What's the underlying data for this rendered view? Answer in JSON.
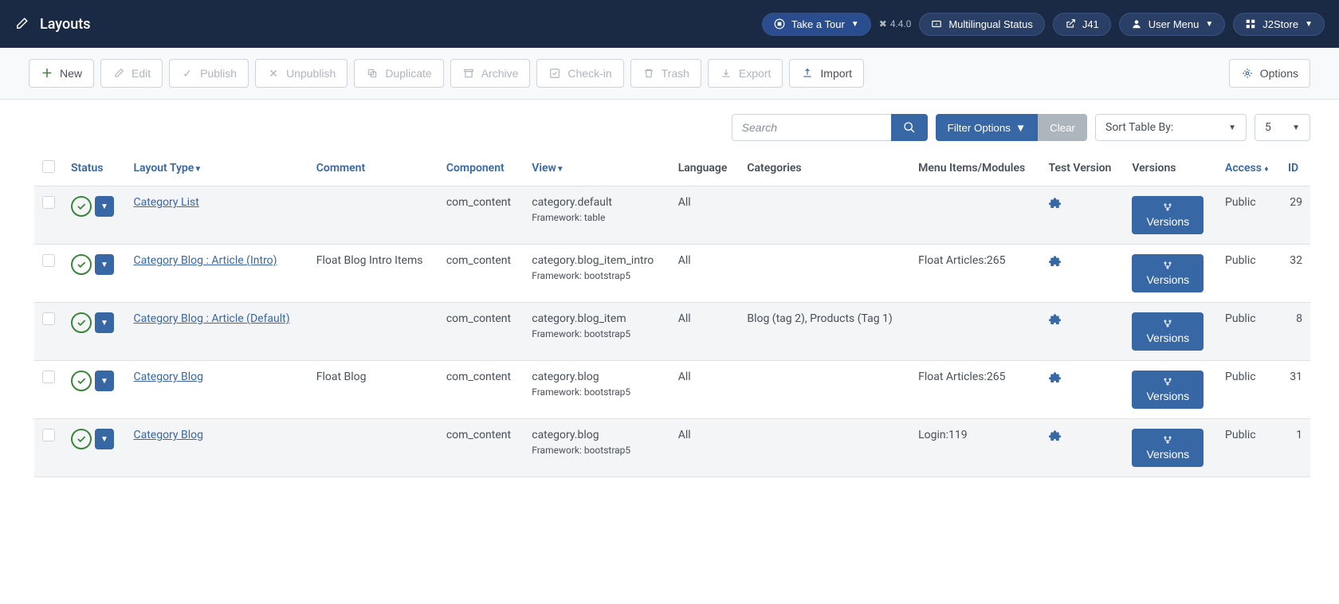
{
  "header": {
    "title": "Layouts",
    "take_tour": "Take a Tour",
    "version": "4.4.0",
    "multilingual": "Multilingual Status",
    "j41": "J41",
    "user_menu": "User Menu",
    "j2store": "J2Store"
  },
  "toolbar": {
    "new": "New",
    "edit": "Edit",
    "publish": "Publish",
    "unpublish": "Unpublish",
    "duplicate": "Duplicate",
    "archive": "Archive",
    "checkin": "Check-in",
    "trash": "Trash",
    "export": "Export",
    "import": "Import",
    "options": "Options"
  },
  "filters": {
    "search_placeholder": "Search",
    "filter_options": "Filter Options",
    "clear": "Clear",
    "sort_by": "Sort Table By:",
    "limit": "5"
  },
  "columns": {
    "status": "Status",
    "layout_type": "Layout Type",
    "comment": "Comment",
    "component": "Component",
    "view": "View",
    "language": "Language",
    "categories": "Categories",
    "menu_items": "Menu Items/Modules",
    "test_version": "Test Version",
    "versions": "Versions",
    "access": "Access",
    "id": "ID"
  },
  "framework_label": "Framework:",
  "versions_btn": "Versions",
  "rows": [
    {
      "layout_type": "Category List",
      "comment": "",
      "component": "com_content",
      "view": "category.default",
      "framework": "table",
      "language": "All",
      "categories": "",
      "menu_items": "",
      "access": "Public",
      "id": "29"
    },
    {
      "layout_type": "Category Blog : Article (Intro)",
      "comment": "Float Blog Intro Items",
      "component": "com_content",
      "view": "category.blog_item_intro",
      "framework": "bootstrap5",
      "language": "All",
      "categories": "",
      "menu_items": "Float Articles:265",
      "access": "Public",
      "id": "32"
    },
    {
      "layout_type": "Category Blog : Article (Default)",
      "comment": "",
      "component": "com_content",
      "view": "category.blog_item",
      "framework": "bootstrap5",
      "language": "All",
      "categories": "Blog (tag 2), Products (Tag 1)",
      "menu_items": "",
      "access": "Public",
      "id": "8"
    },
    {
      "layout_type": "Category Blog",
      "comment": "Float Blog",
      "component": "com_content",
      "view": "category.blog",
      "framework": "bootstrap5",
      "language": "All",
      "categories": "",
      "menu_items": "Float Articles:265",
      "access": "Public",
      "id": "31"
    },
    {
      "layout_type": "Category Blog",
      "comment": "",
      "component": "com_content",
      "view": "category.blog",
      "framework": "bootstrap5",
      "language": "All",
      "categories": "",
      "menu_items": "Login:119",
      "access": "Public",
      "id": "1"
    }
  ]
}
